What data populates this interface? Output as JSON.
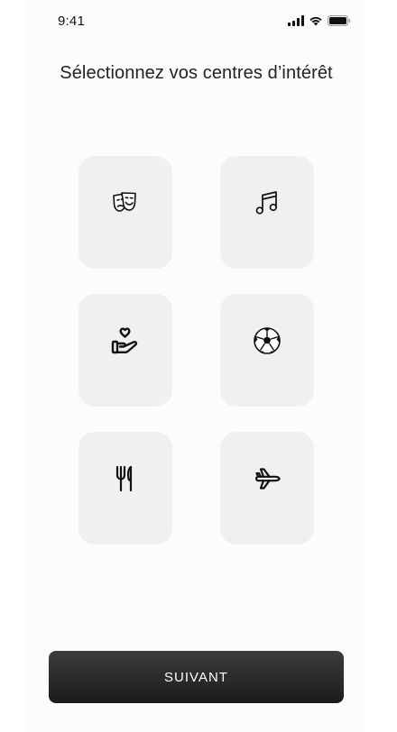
{
  "status_bar": {
    "time": "9:41",
    "icons": [
      "signal-icon",
      "wifi-icon",
      "battery-icon"
    ]
  },
  "title": "Sélectionnez vos centres d’intérêt",
  "interests": [
    {
      "icon": "theater-masks-icon"
    },
    {
      "icon": "music-note-icon"
    },
    {
      "icon": "volunteering-heart-hand-icon"
    },
    {
      "icon": "soccer-ball-icon"
    },
    {
      "icon": "fork-knife-icon"
    },
    {
      "icon": "airplane-icon"
    }
  ],
  "next_button": {
    "label": "SUIVANT"
  },
  "colors": {
    "screen_background": "#fcfcfb",
    "tile_background": "#f1f0ee",
    "button_gradient_top": "#3c3c3f",
    "button_gradient_bottom": "#1c1c1f",
    "button_text": "#ffffff"
  }
}
